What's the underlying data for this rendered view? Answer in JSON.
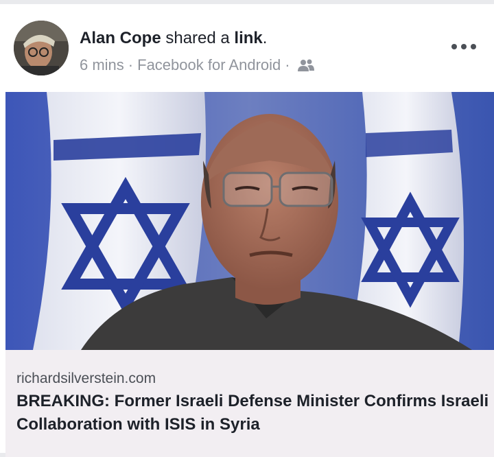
{
  "post": {
    "author": "Alan Cope",
    "action_text": " shared a ",
    "object_text": "link",
    "period": ".",
    "time": "6 mins",
    "separator": "·",
    "app": "Facebook for Android",
    "audience_icon": "friends-icon",
    "more_icon": "ellipsis-icon"
  },
  "link": {
    "domain": "richardsilverstein.com",
    "headline": "BREAKING: Former Israeli Defense Minister Confirms Israeli Collaboration with ISIS in Syria",
    "image": "portrait photo of a bald man with glasses in front of Israeli flags"
  },
  "colors": {
    "author": "#1d2129",
    "meta": "#90949c",
    "caption_bg": "#f2eef2",
    "flag_blue": "#2a3f9d"
  }
}
